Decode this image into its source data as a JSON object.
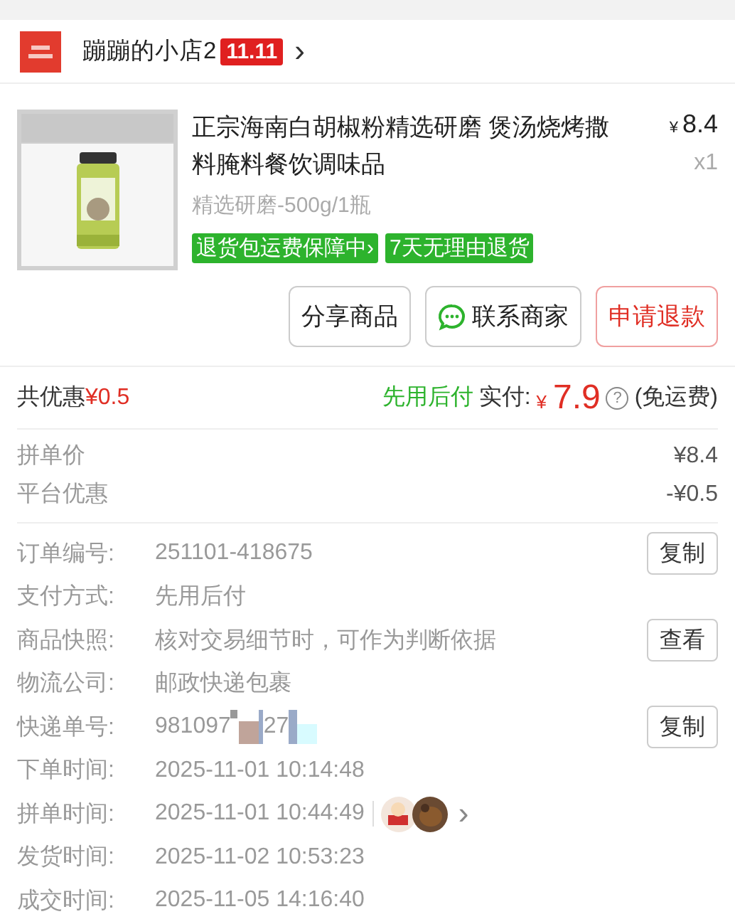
{
  "shop": {
    "name": "蹦蹦的小店2",
    "badge": "11.11",
    "chevron": "›"
  },
  "product": {
    "title": "正宗海南白胡椒粉精选研磨 煲汤烧烤撒料腌料餐饮调味品",
    "currency": "¥",
    "price": "8.4",
    "quantity": "x1",
    "spec": "精选研磨-500g/1瓶",
    "tags": [
      "退货包运费保障中›",
      "7天无理由退货"
    ]
  },
  "actions": [
    {
      "label": "分享商品",
      "kind": "plain"
    },
    {
      "label": "联系商家",
      "kind": "chat"
    },
    {
      "label": "申请退款",
      "kind": "danger"
    }
  ],
  "summary": {
    "discount_label": "共优惠",
    "discount": "¥0.5",
    "pay_later": "先用后付",
    "paid_label": "实付:",
    "currency": "¥",
    "paid": "7.9",
    "help": "?",
    "shipping": "(免运费)"
  },
  "price_lines": [
    {
      "label": "拼单价",
      "value": "¥8.4"
    },
    {
      "label": "平台优惠",
      "value": "-¥0.5"
    }
  ],
  "details": [
    {
      "label": "订单编号:",
      "value": "251101-418675",
      "button": "复制"
    },
    {
      "label": "支付方式:",
      "value": "先用后付"
    },
    {
      "label": "商品快照:",
      "value": "核对交易细节时，可作为判断依据",
      "button": "查看"
    },
    {
      "label": "物流公司:",
      "value": "邮政快递包裹"
    },
    {
      "label": "快递单号:",
      "value": "981097",
      "value_tail": "27",
      "redacted": true,
      "button": "复制"
    },
    {
      "label": "下单时间:",
      "value": "2025-11-01 10:14:48"
    },
    {
      "label": "拼单时间:",
      "value": "2025-11-01 10:44:49",
      "chevron": "›"
    },
    {
      "label": "发货时间:",
      "value": "2025-11-02 10:53:23"
    },
    {
      "label": "成交时间:",
      "value": "2025-11-05 14:16:40"
    }
  ]
}
